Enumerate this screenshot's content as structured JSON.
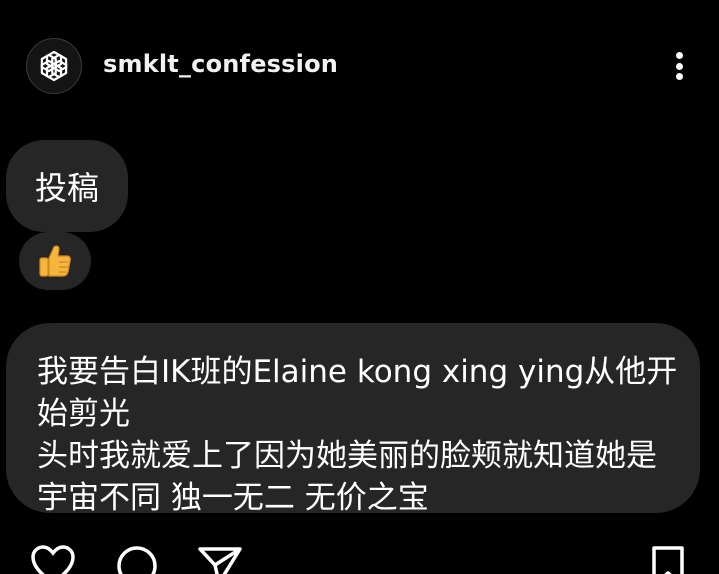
{
  "post": {
    "username": "smklt_confession",
    "avatar_icon": "openai-logo-icon",
    "more_icon": "more-vertical-icon"
  },
  "messages": [
    {
      "text": "投稿"
    },
    {
      "reaction": "thumbs-up-icon"
    },
    {
      "text": "我要告白IK班的Elaine kong xing ying从他开始剪光\n头时我就爱上了因为她美丽的脸颊就知道她是\n宇宙不同 独一无二 无价之宝"
    }
  ],
  "actions": {
    "icons": [
      "heart-icon",
      "comment-icon",
      "share-icon",
      "bookmark-icon"
    ]
  },
  "colors": {
    "background": "#000000",
    "bubble": "#262626",
    "text": "#ffffff",
    "thumb": "#f5b53f"
  }
}
